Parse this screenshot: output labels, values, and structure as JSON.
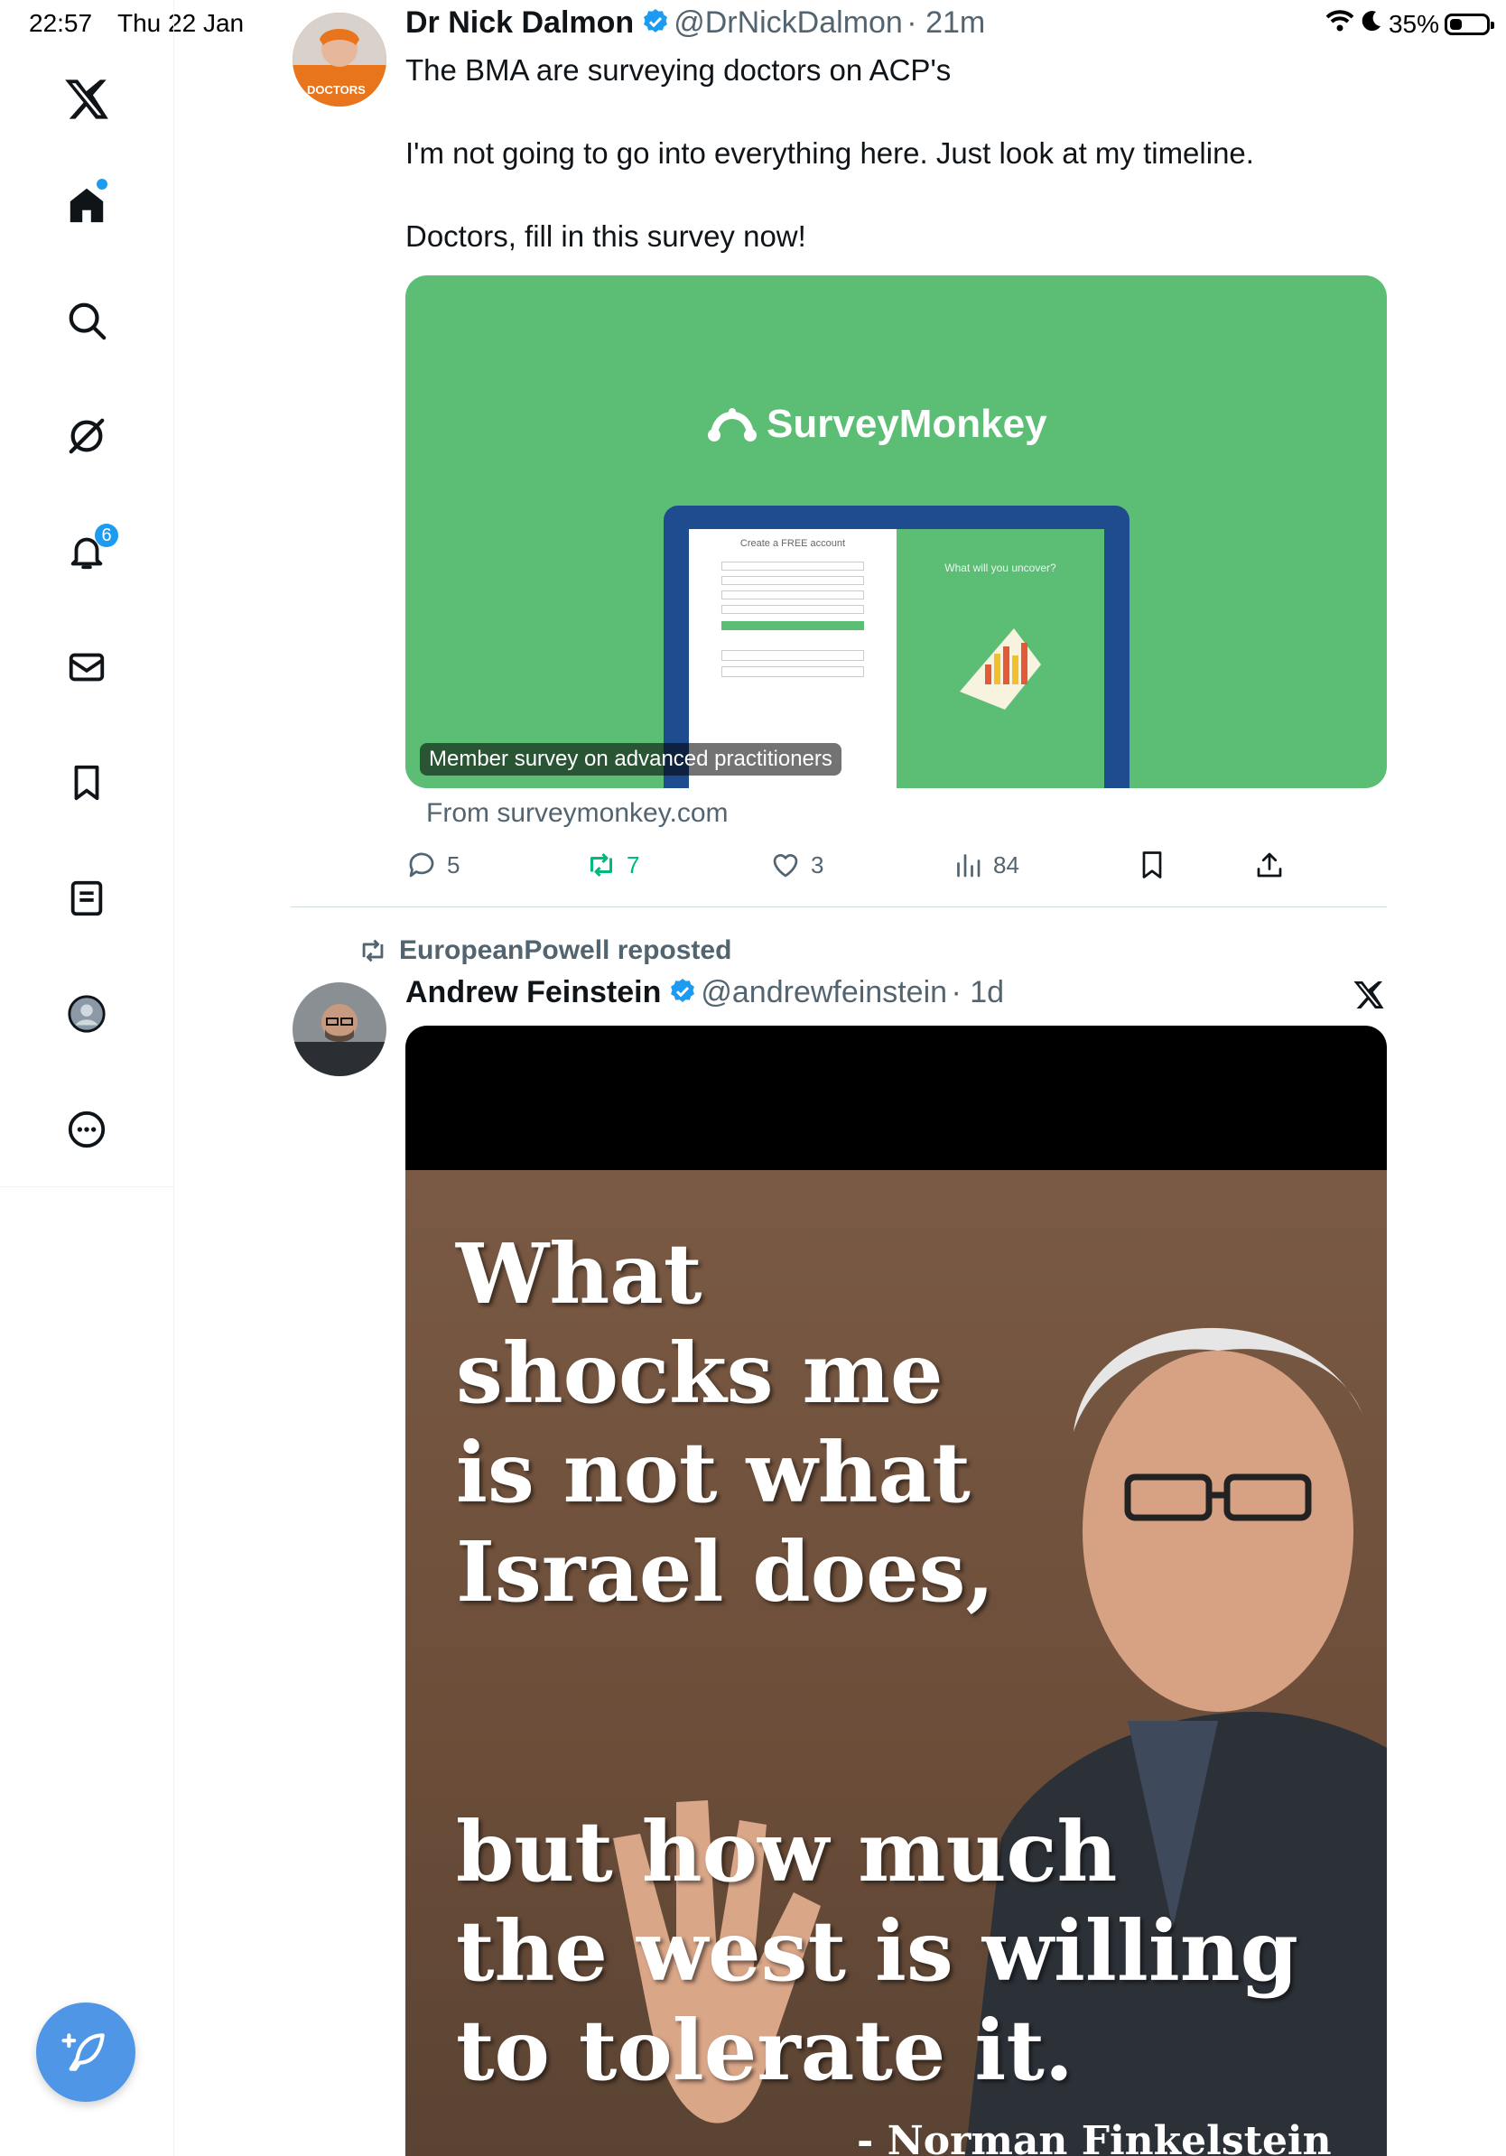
{
  "status_bar": {
    "time": "22:57",
    "date": "Thu 22 Jan",
    "battery": "35%",
    "battery_level": 0.35
  },
  "sidebar": {
    "items": [
      {
        "name": "home-icon"
      },
      {
        "name": "search-icon"
      },
      {
        "name": "grok-icon"
      },
      {
        "name": "notifications-icon",
        "badge": "6"
      },
      {
        "name": "messages-icon"
      },
      {
        "name": "bookmarks-icon"
      },
      {
        "name": "lists-icon"
      },
      {
        "name": "profile-icon"
      },
      {
        "name": "more-icon"
      }
    ]
  },
  "tweet1": {
    "name": "Dr Nick Dalmon",
    "handle": "@DrNickDalmon",
    "time": "· 21m",
    "avatar_text": "DOCTORS",
    "lines": [
      "The BMA are surveying doctors on ACP's",
      "I'm not going to go into everything here. Just look at my timeline.",
      "Doctors, fill in this survey now!"
    ],
    "card": {
      "brand": "SurveyMonkey",
      "form_title": "Create a FREE account",
      "tagline": "What will you uncover?",
      "caption": "Member survey on advanced practitioners",
      "from": "From surveymonkey.com"
    },
    "actions": {
      "replies": "5",
      "reposts": "7",
      "likes": "3",
      "views": "84"
    }
  },
  "tweet2": {
    "repost_label": "EuropeanPowell reposted",
    "name": "Andrew Feinstein",
    "handle": "@andrewfeinstein",
    "time": "· 1d",
    "quote_lines": [
      "What",
      "shocks me",
      "is not what",
      "Israel does,",
      "but how much",
      "the west is willing",
      "to tolerate it."
    ],
    "attribution": "- Norman Finkelstein"
  },
  "colors": {
    "accent": "#1d9bf0",
    "card_green": "#5cbd75",
    "repost_green": "#00ba7c"
  }
}
